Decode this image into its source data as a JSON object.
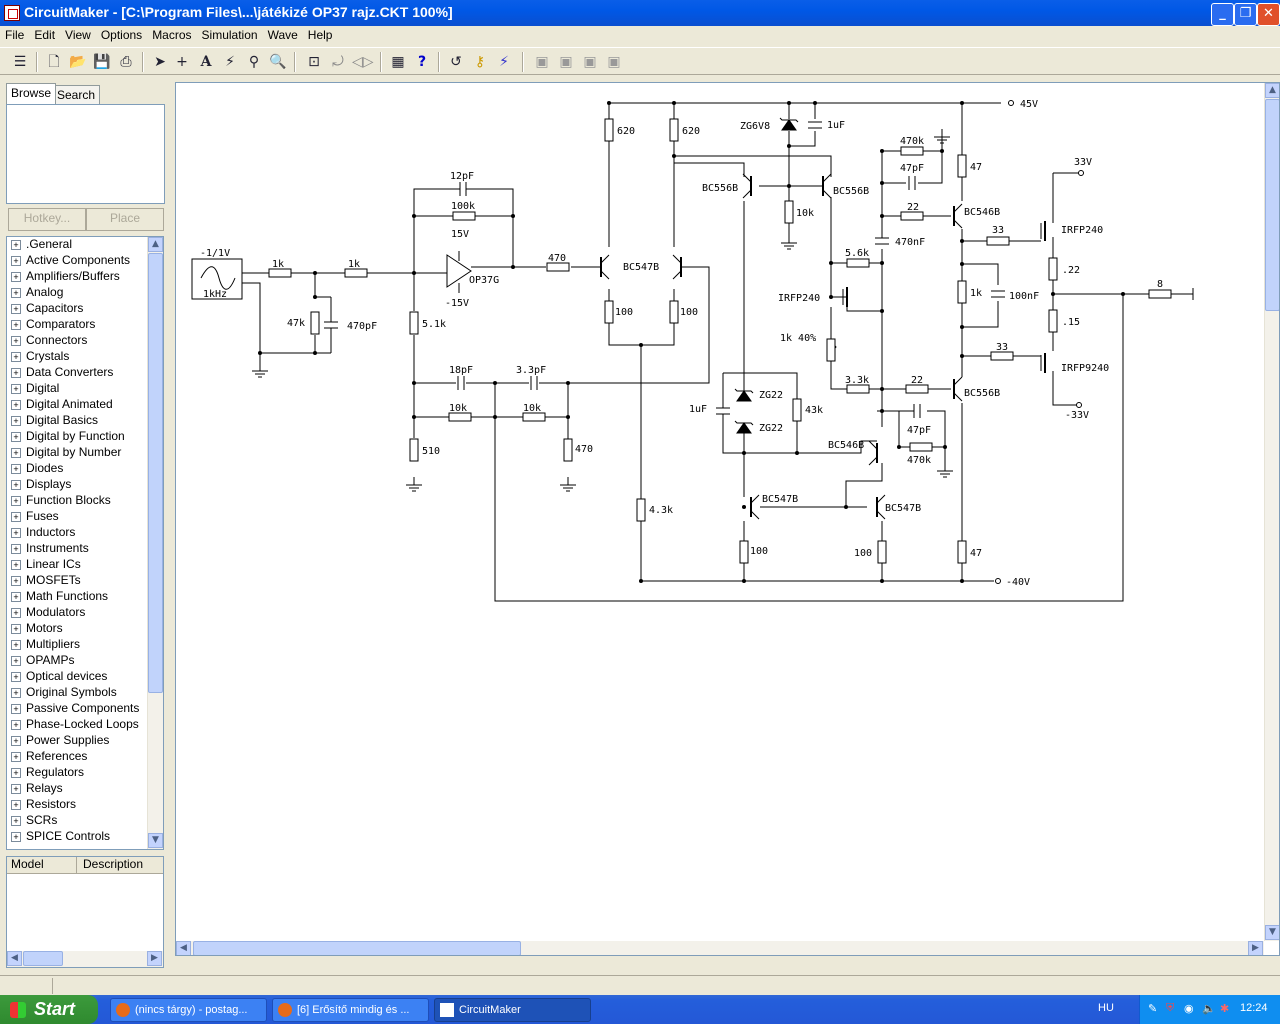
{
  "window": {
    "title": "CircuitMaker - [C:\\Program Files\\...\\játékizé OP37 rajz.CKT 100%]"
  },
  "menu": [
    "File",
    "Edit",
    "View",
    "Options",
    "Macros",
    "Simulation",
    "Wave",
    "Help"
  ],
  "toolbar_icons": [
    "clipboard-icon",
    "new-icon",
    "open-icon",
    "save-icon",
    "print-icon",
    "arrow-tool-icon",
    "wire-tool-icon",
    "text-tool-icon",
    "probe-tool-icon",
    "digital-probe-icon",
    "zoom-icon",
    "fit-icon",
    "rotate-icon",
    "mirror-icon",
    "check-icon",
    "help-icon",
    "reset-icon",
    "step-icon",
    "run-icon",
    "grid1-icon",
    "grid2-icon",
    "grid3-icon",
    "grid4-icon"
  ],
  "browser": {
    "tabs": [
      "Browse",
      "Search"
    ],
    "hotkey_label": "Hotkey...",
    "place_label": "Place",
    "categories": [
      ".General",
      "Active Components",
      "Amplifiers/Buffers",
      "Analog",
      "Capacitors",
      "Comparators",
      "Connectors",
      "Crystals",
      "Data Converters",
      "Digital",
      "Digital Animated",
      "Digital Basics",
      "Digital by Function",
      "Digital by Number",
      "Diodes",
      "Displays",
      "Function Blocks",
      "Fuses",
      "Inductors",
      "Instruments",
      "Linear ICs",
      "MOSFETs",
      "Math Functions",
      "Modulators",
      "Motors",
      "Multipliers",
      "OPAMPs",
      "Optical devices",
      "Original Symbols",
      "Passive Components",
      "Phase-Locked Loops",
      "Power Supplies",
      "References",
      "Regulators",
      "Relays",
      "Resistors",
      "SCRs",
      "SPICE Controls"
    ],
    "model_header": "Model",
    "description_header": "Description"
  },
  "schematic": {
    "source": {
      "amplitude": "-1/1V",
      "freq": "1kHz"
    },
    "labels": {
      "r_in1": "1k",
      "r_in2": "1k",
      "r47k": "47k",
      "c470p": "470pF",
      "c12p": "12pF",
      "r100k": "100k",
      "v15": "15V",
      "vm15": "-15V",
      "opamp": "OP37G",
      "r51k": "5.1k",
      "r510": "510",
      "c18p": "18pF",
      "c33p": "3.3pF",
      "r10k_a": "10k",
      "r10k_b": "10k",
      "r470_b": "470",
      "r470": "470",
      "q1": "BC547B",
      "r620_a": "620",
      "r620_b": "620",
      "r100_a": "100",
      "r100_b": "100",
      "r43k": "4.3k",
      "zg6v8": "ZG6V8",
      "c1u_a": "1uF",
      "q_bc556_a": "BC556B",
      "q_bc556_b": "BC556B",
      "r10k_c": "10k",
      "r470k_a": "470k",
      "c47p_a": "47pF",
      "r22_a": "22",
      "c470n": "470nF",
      "r56k": "5.6k",
      "irfp240_a": "IRFP240",
      "pot": "1k 40%",
      "r33k": "3.3k",
      "r22_b": "22",
      "r43k_b": "43k",
      "zg22_a": "ZG22",
      "zg22_b": "ZG22",
      "c1u_b": "1uF",
      "q_bc546_a": "BC546B",
      "c47p_b": "47pF",
      "r470k_b": "470k",
      "q_bc547_a": "BC547B",
      "q_bc547_b": "BC547B",
      "r100_c": "100",
      "r100_d": "100",
      "v45": "45V",
      "vm40": "-40V",
      "r47_a": "47",
      "r47_b": "47",
      "q_bc546_b": "BC546B",
      "q_bc556_c": "BC556B",
      "r33_a": "33",
      "r33_b": "33",
      "r1k": "1k",
      "c100n": "100nF",
      "v33": "33V",
      "vm33": "-33V",
      "irfp240_b": "IRFP240",
      "irfp9240": "IRFP9240",
      "r022": ".22",
      "r015": ".15",
      "r8": "8"
    }
  },
  "taskbar": {
    "start": "Start",
    "tasks": [
      "(nincs tárgy) - postag...",
      "[6] Erősítő mindig és ...",
      "CircuitMaker"
    ],
    "lang": "HU",
    "clock": "12:24"
  }
}
